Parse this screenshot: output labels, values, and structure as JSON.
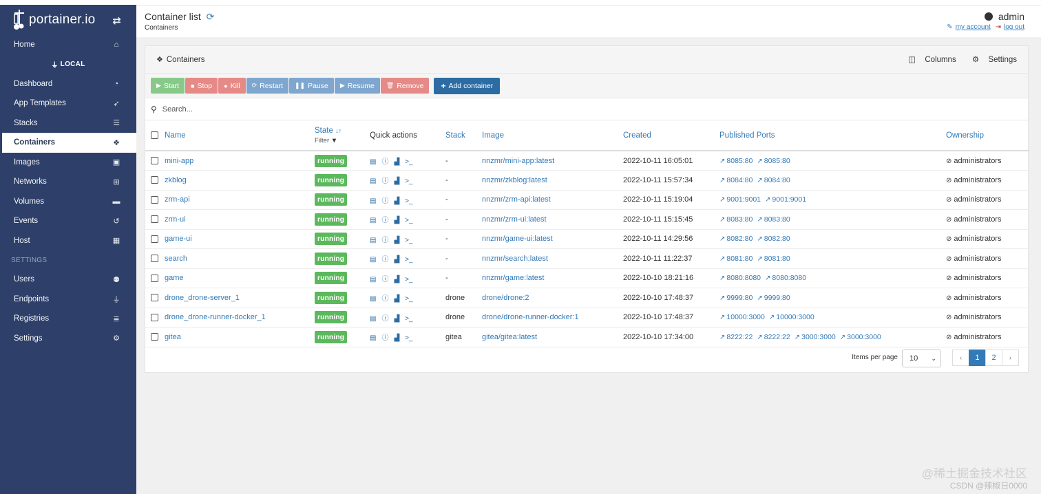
{
  "brand": {
    "name": "portainer.io",
    "toggle_icon": "exchange-icon"
  },
  "sidebar": {
    "env_label": "LOCAL",
    "settings_label": "SETTINGS",
    "items": [
      {
        "label": "Home",
        "icon": "home-icon"
      },
      {
        "label": "Dashboard",
        "icon": "dashboard-icon"
      },
      {
        "label": "App Templates",
        "icon": "rocket-icon"
      },
      {
        "label": "Stacks",
        "icon": "stacks-icon"
      },
      {
        "label": "Containers",
        "icon": "cubes-icon",
        "active": true
      },
      {
        "label": "Images",
        "icon": "images-icon"
      },
      {
        "label": "Networks",
        "icon": "network-icon"
      },
      {
        "label": "Volumes",
        "icon": "hdd-icon"
      },
      {
        "label": "Events",
        "icon": "history-icon"
      },
      {
        "label": "Host",
        "icon": "grid-icon"
      }
    ],
    "settings_items": [
      {
        "label": "Users",
        "icon": "users-icon"
      },
      {
        "label": "Endpoints",
        "icon": "plug-icon"
      },
      {
        "label": "Registries",
        "icon": "database-icon"
      },
      {
        "label": "Settings",
        "icon": "cogs-icon"
      }
    ]
  },
  "header": {
    "title": "Container list",
    "subtitle": "Containers",
    "user": "admin",
    "my_account": "my account",
    "log_out": "log out"
  },
  "panel": {
    "title": "Containers",
    "columns_label": "Columns",
    "settings_label": "Settings"
  },
  "actions": {
    "start": "Start",
    "stop": "Stop",
    "kill": "Kill",
    "restart": "Restart",
    "pause": "Pause",
    "resume": "Resume",
    "remove": "Remove",
    "add": "Add container"
  },
  "search": {
    "placeholder": "Search..."
  },
  "table": {
    "headers": {
      "name": "Name",
      "state": "State",
      "filter": "Filter",
      "quick_actions": "Quick actions",
      "stack": "Stack",
      "image": "Image",
      "created": "Created",
      "ports": "Published Ports",
      "ownership": "Ownership"
    },
    "rows": [
      {
        "name": "mini-app",
        "state": "running",
        "stack": "-",
        "image": "nnzmr/mini-app:latest",
        "created": "2022-10-11 16:05:01",
        "ports": [
          "8085:80",
          "8085:80"
        ],
        "ownership": "administrators"
      },
      {
        "name": "zkblog",
        "state": "running",
        "stack": "-",
        "image": "nnzmr/zkblog:latest",
        "created": "2022-10-11 15:57:34",
        "ports": [
          "8084:80",
          "8084:80"
        ],
        "ownership": "administrators"
      },
      {
        "name": "zrm-api",
        "state": "running",
        "stack": "-",
        "image": "nnzmr/zrm-api:latest",
        "created": "2022-10-11 15:19:04",
        "ports": [
          "9001:9001",
          "9001:9001"
        ],
        "ownership": "administrators"
      },
      {
        "name": "zrm-ui",
        "state": "running",
        "stack": "-",
        "image": "nnzmr/zrm-ui:latest",
        "created": "2022-10-11 15:15:45",
        "ports": [
          "8083:80",
          "8083:80"
        ],
        "ownership": "administrators"
      },
      {
        "name": "game-ui",
        "state": "running",
        "stack": "-",
        "image": "nnzmr/game-ui:latest",
        "created": "2022-10-11 14:29:56",
        "ports": [
          "8082:80",
          "8082:80"
        ],
        "ownership": "administrators"
      },
      {
        "name": "search",
        "state": "running",
        "stack": "-",
        "image": "nnzmr/search:latest",
        "created": "2022-10-11 11:22:37",
        "ports": [
          "8081:80",
          "8081:80"
        ],
        "ownership": "administrators"
      },
      {
        "name": "game",
        "state": "running",
        "stack": "-",
        "image": "nnzmr/game:latest",
        "created": "2022-10-10 18:21:16",
        "ports": [
          "8080:8080",
          "8080:8080"
        ],
        "ownership": "administrators"
      },
      {
        "name": "drone_drone-server_1",
        "state": "running",
        "stack": "drone",
        "image": "drone/drone:2",
        "created": "2022-10-10 17:48:37",
        "ports": [
          "9999:80",
          "9999:80"
        ],
        "ownership": "administrators"
      },
      {
        "name": "drone_drone-runner-docker_1",
        "state": "running",
        "stack": "drone",
        "image": "drone/drone-runner-docker:1",
        "created": "2022-10-10 17:48:37",
        "ports": [
          "10000:3000",
          "10000:3000"
        ],
        "ownership": "administrators"
      },
      {
        "name": "gitea",
        "state": "running",
        "stack": "gitea",
        "image": "gitea/gitea:latest",
        "created": "2022-10-10 17:34:00",
        "ports": [
          "8222:22",
          "8222:22",
          "3000:3000",
          "3000:3000"
        ],
        "ownership": "administrators"
      }
    ]
  },
  "pagination": {
    "items_per_page_label": "Items per page",
    "items_per_page": "10",
    "prev": "‹",
    "pages": [
      "1",
      "2"
    ],
    "next": "›"
  },
  "watermark": {
    "line1": "@稀土掘金技术社区",
    "line2": "CSDN @辣椒日0000"
  }
}
